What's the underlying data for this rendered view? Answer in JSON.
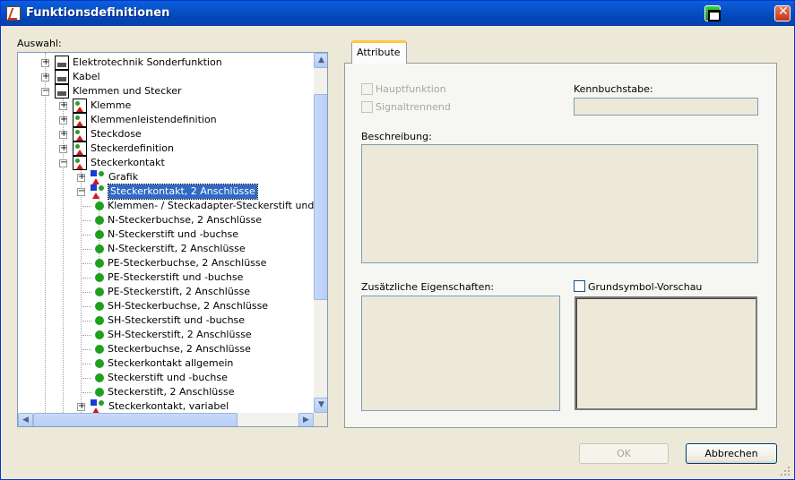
{
  "window": {
    "title": "Funktionsdefinitionen"
  },
  "left": {
    "label": "Auswahl:"
  },
  "tree": {
    "items": [
      {
        "label": "Elektrotechnik Sonderfunktion",
        "level": 1,
        "icon": "printer-icon",
        "expander": "+"
      },
      {
        "label": "Kabel",
        "level": 1,
        "icon": "printer-icon",
        "expander": "+"
      },
      {
        "label": "Klemmen und Stecker",
        "level": 1,
        "icon": "printer-icon",
        "expander": "−"
      },
      {
        "label": "Klemme",
        "level": 2,
        "icon": "symbol-icon",
        "expander": "+"
      },
      {
        "label": "Klemmenleistendefinition",
        "level": 2,
        "icon": "symbol-icon",
        "expander": "+"
      },
      {
        "label": "Steckdose",
        "level": 2,
        "icon": "symbol-icon",
        "expander": "+"
      },
      {
        "label": "Steckerdefinition",
        "level": 2,
        "icon": "symbol-icon",
        "expander": "+"
      },
      {
        "label": "Steckerkontakt",
        "level": 2,
        "icon": "symbol-icon",
        "expander": "−"
      },
      {
        "label": "Grafik",
        "level": 3,
        "icon": "multi-symbol-icon",
        "expander": "+"
      },
      {
        "label": "Steckerkontakt, 2 Anschlüsse",
        "level": 3,
        "icon": "multi-symbol-icon",
        "expander": "−",
        "selected": true
      },
      {
        "label": "Klemmen- / Steckadapter-Steckerstift und -",
        "level": 4,
        "icon": "green-dot-icon"
      },
      {
        "label": "N-Steckerbuchse, 2 Anschlüsse",
        "level": 4,
        "icon": "green-dot-icon"
      },
      {
        "label": "N-Steckerstift und -buchse",
        "level": 4,
        "icon": "green-dot-icon"
      },
      {
        "label": "N-Steckerstift, 2 Anschlüsse",
        "level": 4,
        "icon": "green-dot-icon"
      },
      {
        "label": "PE-Steckerbuchse, 2 Anschlüsse",
        "level": 4,
        "icon": "green-dot-icon"
      },
      {
        "label": "PE-Steckerstift und -buchse",
        "level": 4,
        "icon": "green-dot-icon"
      },
      {
        "label": "PE-Steckerstift, 2 Anschlüsse",
        "level": 4,
        "icon": "green-dot-icon"
      },
      {
        "label": "SH-Steckerbuchse, 2 Anschlüsse",
        "level": 4,
        "icon": "green-dot-icon"
      },
      {
        "label": "SH-Steckerstift und -buchse",
        "level": 4,
        "icon": "green-dot-icon"
      },
      {
        "label": "SH-Steckerstift, 2 Anschlüsse",
        "level": 4,
        "icon": "green-dot-icon"
      },
      {
        "label": "Steckerbuchse, 2 Anschlüsse",
        "level": 4,
        "icon": "green-dot-icon"
      },
      {
        "label": "Steckerkontakt allgemein",
        "level": 4,
        "icon": "green-dot-icon"
      },
      {
        "label": "Steckerstift und -buchse",
        "level": 4,
        "icon": "green-dot-icon"
      },
      {
        "label": "Steckerstift, 2 Anschlüsse",
        "level": 4,
        "icon": "green-dot-icon"
      },
      {
        "label": "Steckerkontakt, variabel",
        "level": 3,
        "icon": "multi-symbol-icon",
        "expander": "+"
      }
    ]
  },
  "tabs": [
    {
      "label": "Attribute",
      "active": true
    }
  ],
  "attributes": {
    "hauptfunktion_label": "Hauptfunktion",
    "signaltrennend_label": "Signaltrennend",
    "kennbuchstabe_label": "Kennbuchstabe:",
    "kennbuchstabe_value": "",
    "beschreibung_label": "Beschreibung:",
    "beschreibung_value": "",
    "zusaetzliche_label": "Zusätzliche Eigenschaften:",
    "grundsymbol_label": "Grundsymbol-Vorschau"
  },
  "buttons": {
    "ok": "OK",
    "cancel": "Abbrechen"
  },
  "colors": {
    "titlebar": "#0a5fd8",
    "selection": "#316ac5",
    "tab_accent": "#ffc83c"
  }
}
